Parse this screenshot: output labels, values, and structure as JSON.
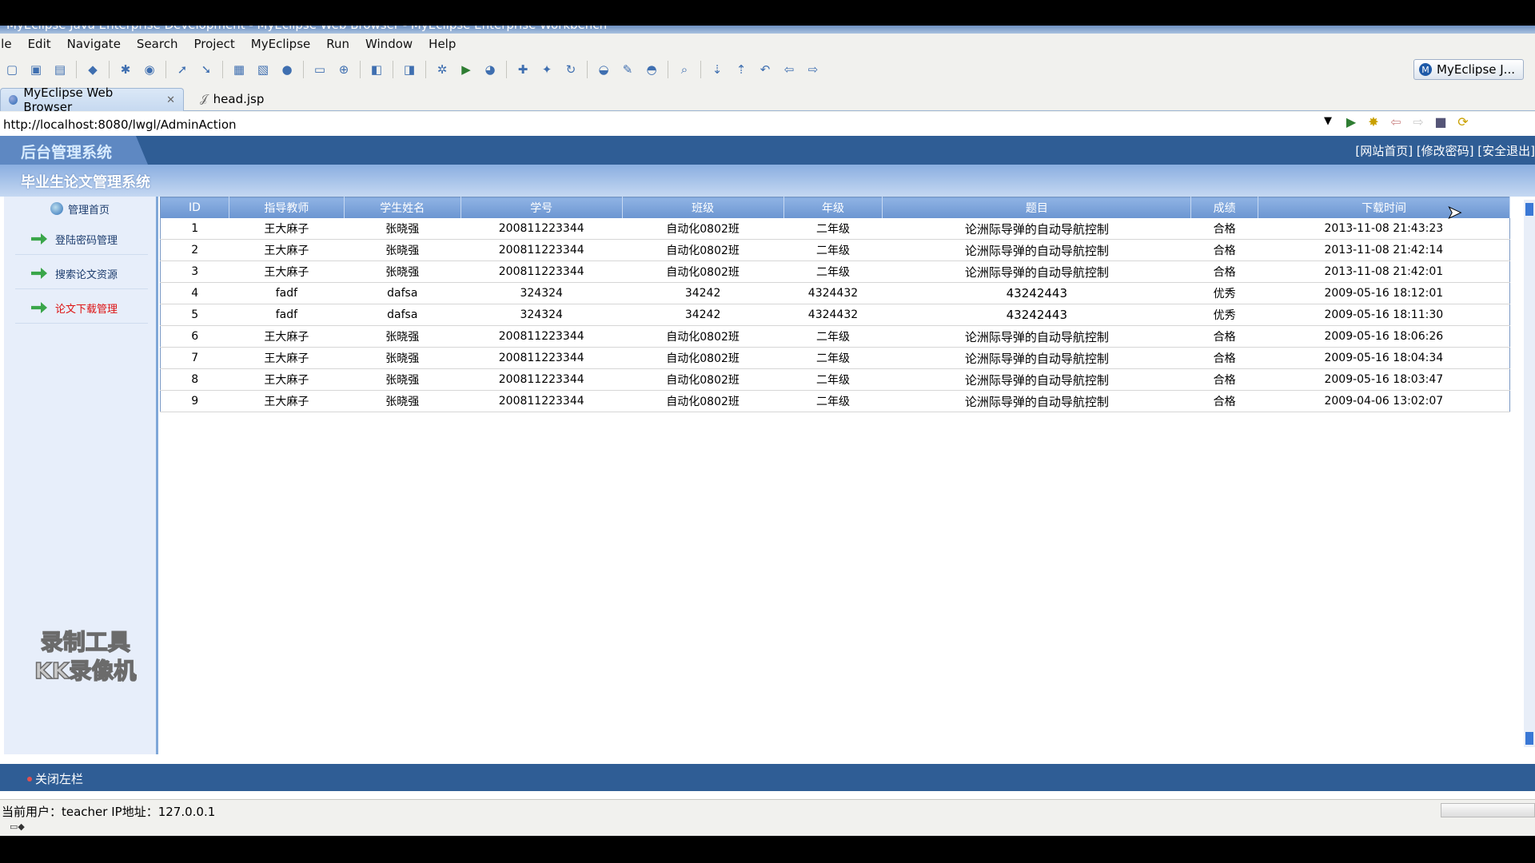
{
  "window": {
    "title": "MyEclipse Java Enterprise Development - MyEclipse Web Browser - MyEclipse Enterprise Workbench"
  },
  "menu": [
    "ile",
    "Edit",
    "Navigate",
    "Search",
    "Project",
    "MyEclipse",
    "Run",
    "Window",
    "Help"
  ],
  "toolbar": {
    "perspective_label": "MyEclipse J..."
  },
  "tabs": [
    {
      "label": "MyEclipse Web Browser",
      "active": true
    },
    {
      "label": "head.jsp",
      "active": false
    }
  ],
  "address": {
    "url": "http://localhost:8080/lwgl/AdminAction"
  },
  "web": {
    "logo": "后台管理系统",
    "top_links": "[网站首页] [修改密码] [安全退出]",
    "system_title": "毕业生论文管理系统",
    "sidebar": {
      "home": "管理首页",
      "items": [
        "登陆密码管理",
        "搜索论文资源",
        "论文下载管理"
      ]
    },
    "watermark_line1": "录制工具",
    "watermark_line2": "KK录像机",
    "table": {
      "headers": [
        "ID",
        "指导教师",
        "学生姓名",
        "学号",
        "班级",
        "年级",
        "题目",
        "成绩",
        "下载时间"
      ],
      "rows": [
        [
          "1",
          "王大麻子",
          "张晓强",
          "200811223344",
          "自动化0802班",
          "二年级",
          "论洲际导弹的自动导航控制",
          "合格",
          "2013-11-08 21:43:23"
        ],
        [
          "2",
          "王大麻子",
          "张晓强",
          "200811223344",
          "自动化0802班",
          "二年级",
          "论洲际导弹的自动导航控制",
          "合格",
          "2013-11-08 21:42:14"
        ],
        [
          "3",
          "王大麻子",
          "张晓强",
          "200811223344",
          "自动化0802班",
          "二年级",
          "论洲际导弹的自动导航控制",
          "合格",
          "2013-11-08 21:42:01"
        ],
        [
          "4",
          "fadf",
          "dafsa",
          "324324",
          "34242",
          "4324432",
          "43242443",
          "优秀",
          "2009-05-16 18:12:01"
        ],
        [
          "5",
          "fadf",
          "dafsa",
          "324324",
          "34242",
          "4324432",
          "43242443",
          "优秀",
          "2009-05-16 18:11:30"
        ],
        [
          "6",
          "王大麻子",
          "张晓强",
          "200811223344",
          "自动化0802班",
          "二年级",
          "论洲际导弹的自动导航控制",
          "合格",
          "2009-05-16 18:06:26"
        ],
        [
          "7",
          "王大麻子",
          "张晓强",
          "200811223344",
          "自动化0802班",
          "二年级",
          "论洲际导弹的自动导航控制",
          "合格",
          "2009-05-16 18:04:34"
        ],
        [
          "8",
          "王大麻子",
          "张晓强",
          "200811223344",
          "自动化0802班",
          "二年级",
          "论洲际导弹的自动导航控制",
          "合格",
          "2009-05-16 18:03:47"
        ],
        [
          "9",
          "王大麻子",
          "张晓强",
          "200811223344",
          "自动化0802班",
          "二年级",
          "论洲际导弹的自动导航控制",
          "合格",
          "2009-04-06 13:02:07"
        ]
      ]
    },
    "footer": {
      "close_sidebar": "关闭左栏"
    },
    "status": "当前用户：teacher  IP地址：127.0.0.1"
  },
  "colors": {
    "header_blue": "#2f5d95",
    "table_header": "#7aa1d8",
    "sidebar_bg": "#e7eefa"
  }
}
